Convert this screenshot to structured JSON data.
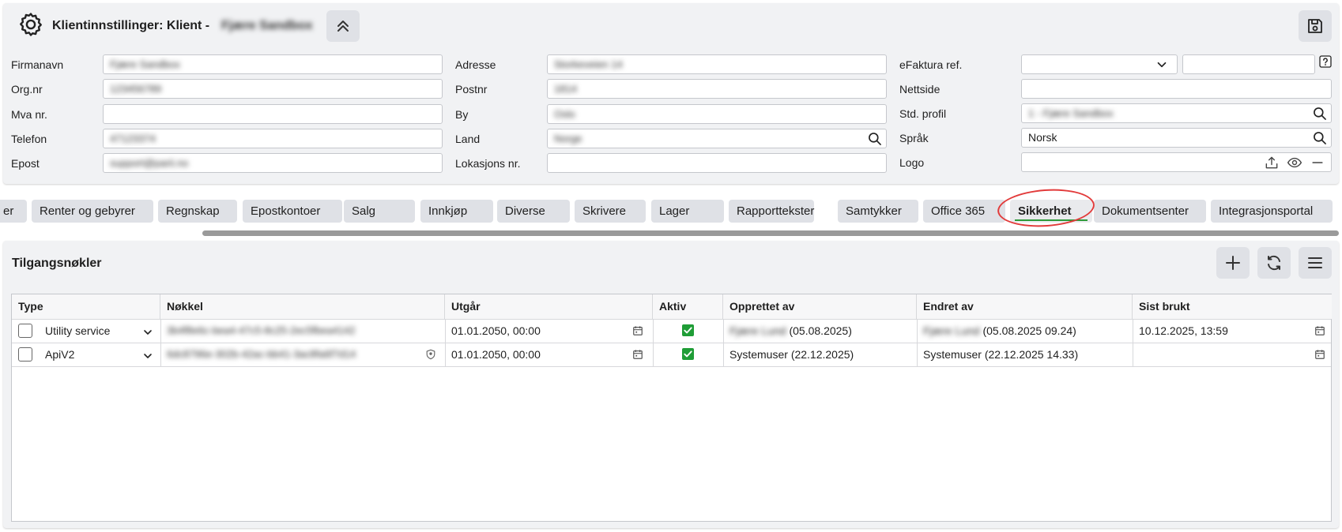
{
  "header": {
    "title": "Klientinnstillinger: Klient -",
    "client_name": "Fjære Sandbox"
  },
  "form": {
    "col1": {
      "firmanavn_label": "Firmanavn",
      "firmanavn_value": "Fjære Sandbox",
      "orgnr_label": "Org.nr",
      "orgnr_value": "123456789",
      "mva_label": "Mva nr.",
      "mva_value": "",
      "telefon_label": "Telefon",
      "telefon_value": "47123374",
      "epost_label": "Epost",
      "epost_value": "support@parii.no"
    },
    "col2": {
      "adresse_label": "Adresse",
      "adresse_value": "Storkeveien 14",
      "postnr_label": "Postnr",
      "postnr_value": "1814",
      "by_label": "By",
      "by_value": "Oslo",
      "land_label": "Land",
      "land_value": "Norge",
      "lokasjon_label": "Lokasjons nr.",
      "lokasjon_value": ""
    },
    "col3": {
      "efaktura_label": "eFaktura ref.",
      "efaktura_select_value": "",
      "efaktura_value": "",
      "nettside_label": "Nettside",
      "nettside_value": "",
      "profil_label": "Std. profil",
      "profil_value": "1 - Fjære Sandbox",
      "sprak_label": "Språk",
      "sprak_value": "Norsk",
      "logo_label": "Logo",
      "logo_value": ""
    }
  },
  "tabs": [
    {
      "label": "er"
    },
    {
      "label": "Renter og gebyrer"
    },
    {
      "label": "Regnskap"
    },
    {
      "label": "Epostkontoer"
    },
    {
      "label": "Salg"
    },
    {
      "label": "Innkjøp"
    },
    {
      "label": "Diverse"
    },
    {
      "label": "Skrivere"
    },
    {
      "label": "Lager"
    },
    {
      "label": "Rapporttekster"
    },
    {
      "label": "Samtykker"
    },
    {
      "label": "Office 365"
    },
    {
      "label": "Sikkerhet",
      "active": true
    },
    {
      "label": "Dokumentsenter"
    },
    {
      "label": "Integrasjonsportal"
    }
  ],
  "section": {
    "title": "Tilgangsnøkler"
  },
  "table": {
    "columns": [
      "Type",
      "Nøkkel",
      "Utgår",
      "Aktiv",
      "Opprettet av",
      "Endret av",
      "Sist brukt"
    ],
    "rows": [
      {
        "type": "Utility service",
        "key": "3b4f8e6c-bea4-47c5-8c25-2ec5fbea4142",
        "expires": "01.01.2050, 00:00",
        "active": true,
        "created_by_name": "Fjære Lund",
        "created_by_date": "(05.08.2025)",
        "changed_by_name": "Fjære Lund",
        "changed_by_date": "(05.08.2025 09.24)",
        "last_used": "10.12.2025, 13:59"
      },
      {
        "type": "ApiV2",
        "key": "6dc8796e-302b-42ac-bb41-3ac8fa6f7d14",
        "expires": "01.01.2050, 00:00",
        "active": true,
        "created_by_name": "Systemuser",
        "created_by_date": "(22.12.2025)",
        "changed_by_name": "Systemuser",
        "changed_by_date": "(22.12.2025 14.33)",
        "last_used": ""
      }
    ]
  },
  "colors": {
    "accent_green": "#1f9d36",
    "highlight_ring": "#e23b3b",
    "button_bg": "#dfe1e6"
  }
}
